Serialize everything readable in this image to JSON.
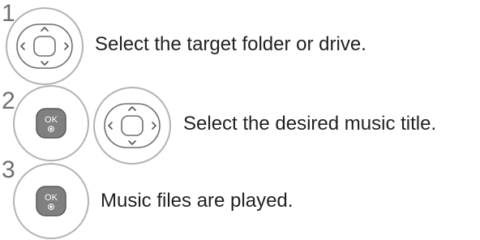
{
  "steps": [
    {
      "number": "1",
      "text": "Select the target folder or drive.",
      "buttons": [
        "nav-pad-icon"
      ]
    },
    {
      "number": "2",
      "text": "Select the desired music title.",
      "buttons": [
        "ok-button-icon",
        "nav-pad-icon"
      ]
    },
    {
      "number": "3",
      "text": "Music files are played.",
      "buttons": [
        "ok-button-icon"
      ]
    }
  ],
  "ok_label": "OK",
  "colors": {
    "circle_stroke": "#b3b3b3",
    "ok_fill": "#808080",
    "text": "#231f20",
    "step_number": "#6d6e71"
  }
}
